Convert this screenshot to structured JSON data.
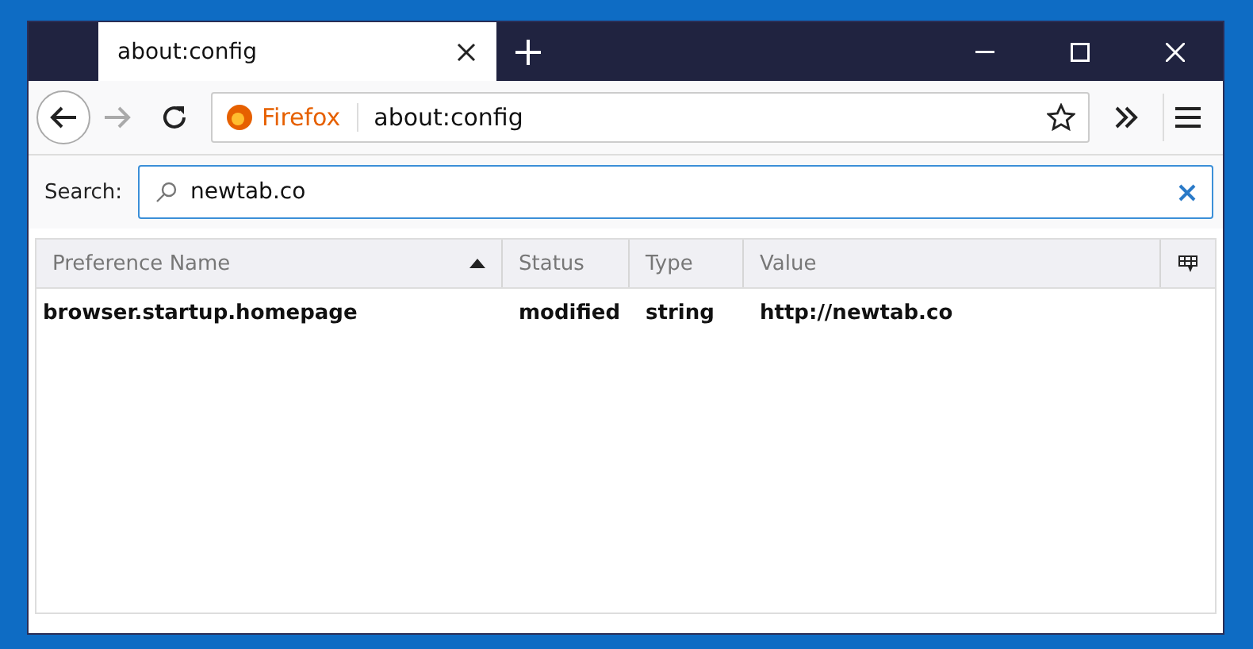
{
  "tabs": [
    {
      "title": "about:config",
      "selected": true
    }
  ],
  "address_bar": {
    "brand": "Firefox",
    "url": "about:config"
  },
  "search": {
    "label": "Search:",
    "value": "newtab.co"
  },
  "table": {
    "columns": [
      {
        "label": "Preference Name",
        "sorted": true
      },
      {
        "label": "Status",
        "sorted": false
      },
      {
        "label": "Type",
        "sorted": false
      },
      {
        "label": "Value",
        "sorted": false
      }
    ],
    "rows": [
      {
        "cells": [
          "browser.startup.homepage",
          "modified",
          "string",
          "http://newtab.co"
        ]
      }
    ]
  }
}
